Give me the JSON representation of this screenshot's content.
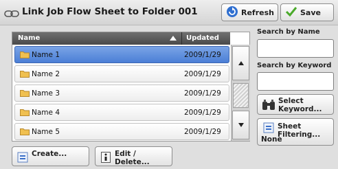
{
  "header": {
    "title": "Link Job Flow Sheet to Folder 001",
    "title_icon": "chain-link-icon",
    "refresh_label": "Refresh",
    "save_label": "Save"
  },
  "list": {
    "columns": {
      "name": "Name",
      "updated": "Updated"
    },
    "sort": "name-ascending",
    "selected_index": 0,
    "rows": [
      {
        "name": "Name 1",
        "updated": "2009/1/29"
      },
      {
        "name": "Name 2",
        "updated": "2009/1/29"
      },
      {
        "name": "Name 3",
        "updated": "2009/1/29"
      },
      {
        "name": "Name 4",
        "updated": "2009/1/29"
      },
      {
        "name": "Name 5",
        "updated": "2009/1/29"
      }
    ]
  },
  "sidebar": {
    "search_by_name_label": "Search by Name",
    "search_by_name_value": "",
    "search_by_keyword_label": "Search by Keyword",
    "search_by_keyword_value": "",
    "select_keyword_line1": "Select",
    "select_keyword_line2": "Keyword...",
    "sheet_filtering_label": "Sheet Filtering...",
    "sheet_filtering_value": "None"
  },
  "footer": {
    "create_label": "Create...",
    "edit_delete_label": "Edit / Delete..."
  },
  "colors": {
    "selected_row": "#5a8ee0",
    "header_column": "#5a5a5a",
    "refresh_icon": "#2f6fd0",
    "save_check": "#4aaa2a",
    "folder": "#f0c050"
  }
}
